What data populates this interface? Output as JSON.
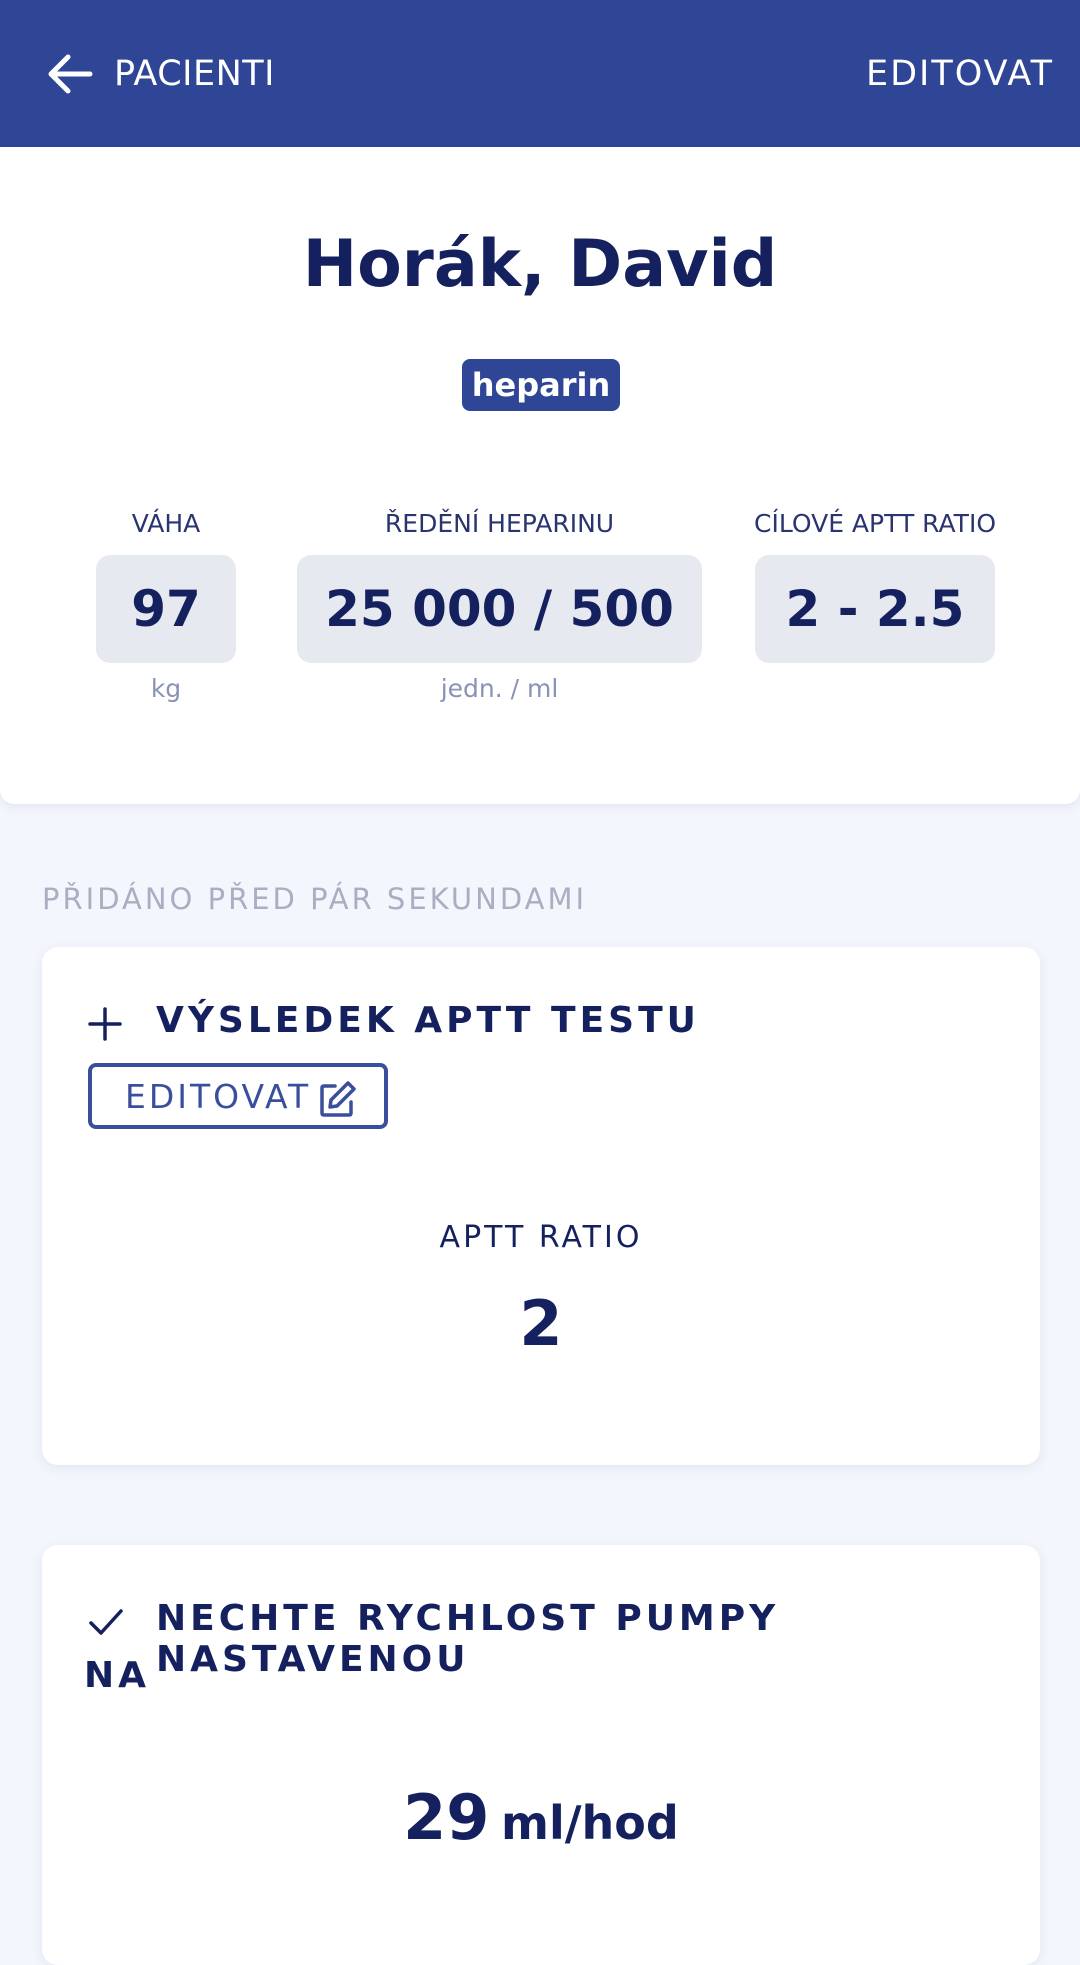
{
  "header": {
    "back_label": "PACIENTI",
    "edit_label": "EDITOVAT",
    "background_color": "#2f4596"
  },
  "patient": {
    "name": "Horák, David",
    "badge": "heparin",
    "stats": [
      {
        "label": "VÁHA",
        "value": "97",
        "unit": "kg"
      },
      {
        "label": "ŘEDĚNÍ HEPARINU",
        "value": "25 000 / 500",
        "unit": "jedn. / ml"
      },
      {
        "label": "CÍLOVÉ APTT RATIO",
        "value": "2 - 2.5",
        "unit": ""
      }
    ]
  },
  "history": {
    "added_label": "PŘIDÁNO PŘED PÁR SEKUNDAMI",
    "test_card": {
      "icon": "plus-icon",
      "title": "VÝSLEDEK APTT TESTU",
      "edit_label": "EDITOVAT",
      "edit_icon": "edit-icon",
      "metric_label": "APTT RATIO",
      "metric_value": "2"
    },
    "pump_card": {
      "icon": "check-icon",
      "title_line1": "NECHTE RYCHLOST PUMPY NASTAVENOU",
      "title_line2": "NA",
      "rate_value": "29",
      "rate_unit": "ml/hod"
    }
  },
  "colors": {
    "primary": "#2f4596",
    "text_dark": "#15215e",
    "page_background": "#f3f6fc",
    "value_box": "#e7e9f1"
  }
}
